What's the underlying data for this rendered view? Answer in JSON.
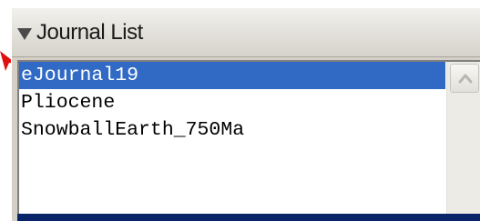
{
  "panel": {
    "title": "Journal List",
    "collapse_icon": "triangle-down-icon"
  },
  "journal_list": {
    "items": [
      {
        "label": "eJournal19",
        "selected": true
      },
      {
        "label": "Pliocene",
        "selected": false
      },
      {
        "label": "SnowballEarth_750Ma",
        "selected": false
      }
    ]
  },
  "scrollbar": {
    "up_icon": "chevron-up-icon"
  },
  "annotation": {
    "icon": "arrow-pointer-icon",
    "color": "#e01010"
  },
  "colors": {
    "selection": "#316ac5",
    "selected_text": "#ffffff",
    "panel_background": "#d4d0c8",
    "list_background": "#ffffff",
    "bottom_bar": "#0a246a"
  }
}
